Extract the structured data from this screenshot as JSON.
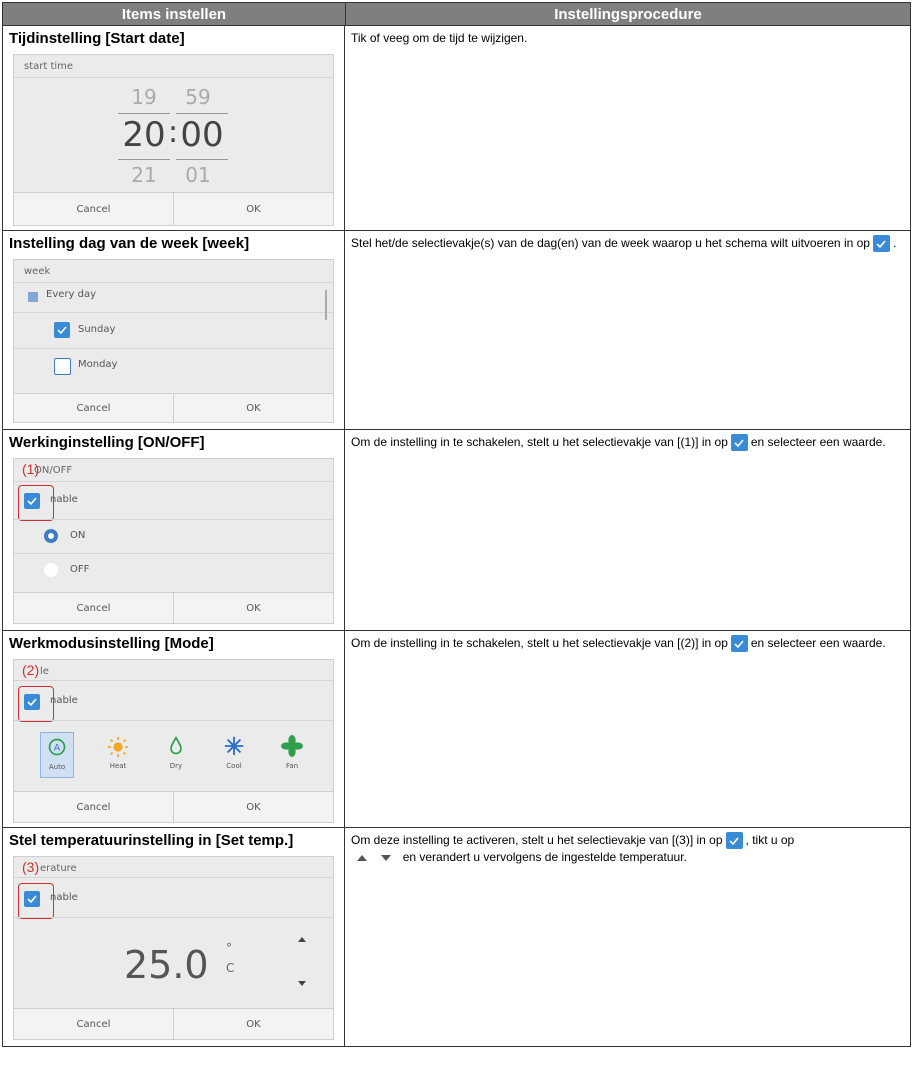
{
  "header": {
    "col1": "Items instellen",
    "col2": "Instellingsprocedure"
  },
  "rows": [
    {
      "title": "Tijdinstelling [Start date]",
      "desc": "Tik of veeg om de tijd te wijzigen.",
      "shot": {
        "label": "start time",
        "prev_hour": "19",
        "prev_min": "59",
        "hour": "20",
        "colon": ":",
        "minute": "00",
        "next_hour": "21",
        "next_min": "01",
        "cancel": "Cancel",
        "ok": "OK"
      }
    },
    {
      "title": "Instelling dag van de week [week]",
      "desc_a": "Stel het/de selectievakje(s) van de dag(en) van de week waarop u het schema wilt uitvoeren in op",
      "desc_b": ".",
      "shot": {
        "label": "week",
        "every_day": "Every day",
        "sunday": "Sunday",
        "monday": "Monday",
        "cancel": "Cancel",
        "ok": "OK"
      }
    },
    {
      "title": "Werkinginstelling [ON/OFF]",
      "desc_a": "Om de instelling in te schakelen, stelt u het selectievakje van [(1)] in op",
      "desc_b": "en selecteer een waarde.",
      "shot": {
        "label": "ON/OFF",
        "marker": "(1)",
        "enable": "nable",
        "on": "ON",
        "off": "OFF",
        "cancel": "Cancel",
        "ok": "OK"
      }
    },
    {
      "title": "Werkmodusinstelling [Mode]",
      "desc_a": "Om de instelling in te schakelen, stelt u het selectievakje van [(2)] in op",
      "desc_b": "en selecteer een waarde.",
      "shot": {
        "label": "le",
        "marker": "(2)",
        "enable": "nable",
        "modes": [
          "Auto",
          "Heat",
          "Dry",
          "Cool",
          "Fan"
        ],
        "cancel": "Cancel",
        "ok": "OK"
      }
    },
    {
      "title": "Stel temperatuurinstelling in [Set temp.]",
      "desc_a": "Om deze instelling te activeren, stelt u het selectievakje van [(3)] in op",
      "desc_b": ", tikt u op",
      "desc_c": "en verandert u vervolgens de ingestelde temperatuur.",
      "shot": {
        "label": "erature",
        "marker": "(3)",
        "enable": "nable",
        "temp": "25.0",
        "deg": "°",
        "unit": "C",
        "cancel": "Cancel",
        "ok": "OK"
      }
    }
  ],
  "colors": {
    "header_bg": "#7f7f7f",
    "checkbox": "#3a8bd6",
    "marker": "#d03030",
    "heat": "#f5a623",
    "cool": "#2a6fc9",
    "fan": "#2e9e4e"
  }
}
